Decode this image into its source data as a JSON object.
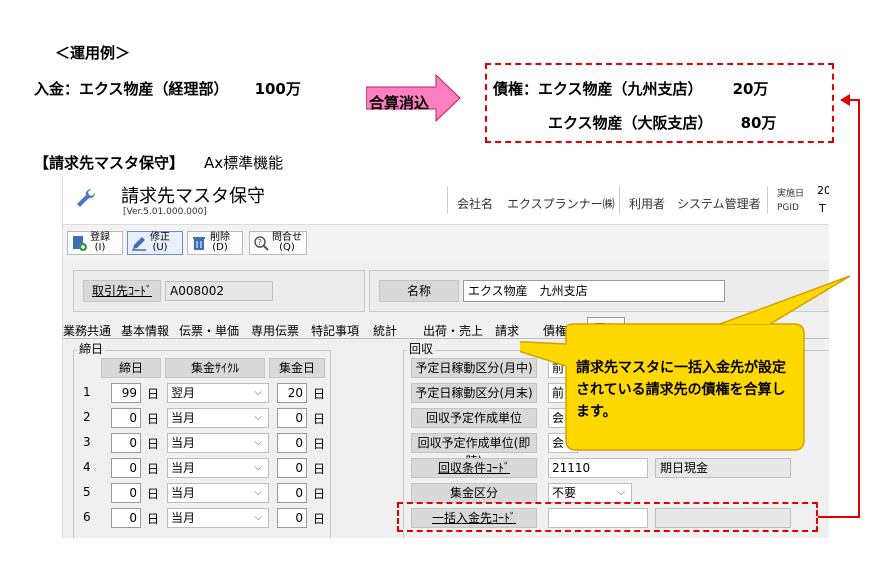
{
  "example": {
    "title": "＜運用例＞"
  },
  "payment": {
    "label": "入金：エクス物産（経理部）",
    "amount": "100万"
  },
  "merge": {
    "label": "合算消込"
  },
  "debts": [
    {
      "label": "債権：エクス物産（九州支店）",
      "amount": "20万"
    },
    {
      "label": "エクス物産（大阪支店）",
      "amount": "80万"
    }
  ],
  "screen_caption": {
    "bracket": "【請求先マスタ保守】",
    "text": "Ax標準機能"
  },
  "app": {
    "title": "請求先マスタ保守",
    "version": "[Ver.5.01.000.000]",
    "company_label": "会社名",
    "company_value": "エクスプランナー㈱",
    "user_label": "利用者",
    "user_value": "システム管理者",
    "date_label": "実施日",
    "date_value": "20",
    "pgid_label": "PGID",
    "pgid_value": "T"
  },
  "toolbar": [
    {
      "label": "登録",
      "key": "(I)"
    },
    {
      "label": "修正",
      "key": "(U)"
    },
    {
      "label": "削除",
      "key": "(D)"
    },
    {
      "label": "問合せ",
      "key": "(Q)"
    }
  ],
  "client": {
    "code_label": "取引先ｺｰﾄﾞ",
    "code_value": "A008002",
    "name_label": "名称",
    "name_value": "エクス物産　九州支店"
  },
  "tabs": [
    "業務共通",
    "基本情報",
    "伝票・単価",
    "専用伝票",
    "特記事項",
    "統計",
    "出荷・売上",
    "請求",
    "債権",
    "回収"
  ],
  "closing": {
    "group_title": "締日",
    "col_day": "締日",
    "col_cycle": "集金ｻｲｸﾙ",
    "col_collect_day": "集金日",
    "unit": "日",
    "rows": [
      {
        "no": "1",
        "day": "99",
        "cycle": "翌月",
        "collect": "20"
      },
      {
        "no": "2",
        "day": "0",
        "cycle": "当月",
        "collect": "0"
      },
      {
        "no": "3",
        "day": "0",
        "cycle": "当月",
        "collect": "0"
      },
      {
        "no": "4",
        "day": "0",
        "cycle": "当月",
        "collect": "0"
      },
      {
        "no": "5",
        "day": "0",
        "cycle": "当月",
        "collect": "0"
      },
      {
        "no": "6",
        "day": "0",
        "cycle": "当月",
        "collect": "0"
      }
    ]
  },
  "collection": {
    "group_title": "回収",
    "rows": [
      {
        "label": "予定日稼動区分(月中)",
        "value": "前"
      },
      {
        "label": "予定日稼動区分(月末)",
        "value": "前"
      },
      {
        "label": "回収予定作成単位",
        "value": "会"
      },
      {
        "label": "回収予定作成単位(即時)",
        "value": "会"
      },
      {
        "label": "回収条件ｺｰﾄﾞ",
        "value": "21110",
        "extra": "期日現金"
      },
      {
        "label": "集金区分",
        "value": "不要"
      },
      {
        "label": "一括入金先ｺｰﾄﾞ",
        "value": "",
        "extra": ""
      }
    ]
  },
  "callout": {
    "text": "請求先マスタに一括入金先が設定されている請求先の債権を合算します。"
  },
  "colors": {
    "highlight_red": "#e00000",
    "callout_yellow": "#ffd800",
    "arrow_pink": "#ff80c0"
  }
}
